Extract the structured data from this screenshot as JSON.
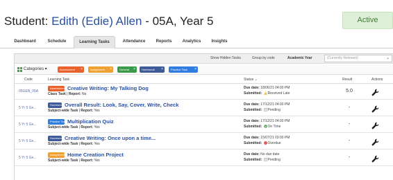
{
  "header": {
    "title_prefix": "Student: ",
    "student_name": "Edith (Edie) Allen",
    "title_suffix": " - 05A, Year 5",
    "status": "Active"
  },
  "tabs": [
    {
      "label": "Dashboard",
      "active": false
    },
    {
      "label": "Schedule",
      "active": false
    },
    {
      "label": "Learning Tasks",
      "active": true
    },
    {
      "label": "Attendance",
      "active": false
    },
    {
      "label": "Reports",
      "active": false
    },
    {
      "label": "Analytics",
      "active": false
    },
    {
      "label": "Insights",
      "active": false
    }
  ],
  "toolbar": {
    "show_hidden": "Show Hidden Tasks",
    "group_by": "Group by code",
    "academic_year_label": "Academic Year",
    "academic_year_value": "(Currently Relevant)"
  },
  "categories": {
    "label": "Categories ▾",
    "chips": [
      {
        "label": "Assessment",
        "color": "#e8602c"
      },
      {
        "label": "Assignment",
        "color": "#f0a030"
      },
      {
        "label": "General",
        "color": "#3a9a4a"
      },
      {
        "label": "Homework",
        "color": "#3d5a99"
      },
      {
        "label": "Practice Task",
        "color": "#2f7de1"
      }
    ]
  },
  "table": {
    "columns": [
      "Code",
      "Learning Task",
      "Status ⌄",
      "Result",
      "Actions"
    ],
    "rows": [
      {
        "code": "05GEN_05A",
        "category": "Assessment",
        "category_color": "#e8602c",
        "title": "Creative Writing: My Talking Dog",
        "type": "Class Task",
        "report": "No",
        "due": "18/06/21 04:00 PM",
        "submitted": "Received Late",
        "status_icon": "warning-icon",
        "result": "5.0"
      },
      {
        "code": "5 Yr 5 Ge...",
        "category": "Homework",
        "category_color": "#3d5a99",
        "title": "Overall Result: Look, Say, Cover, Write, Check",
        "type": "Subject-wide Task",
        "report": "Yes",
        "due": "17/12/21 04:00 PM",
        "submitted": "Pending",
        "status_icon": "pending-icon",
        "result": "-"
      },
      {
        "code": "5 Yr 5 Ge...",
        "category": "Practice Task",
        "category_color": "#2f7de1",
        "title": "Multiplication Quiz",
        "type": "Subject-wide Task",
        "report": "Yes",
        "due": "17/12/21 04:00 PM",
        "submitted": "On Time",
        "status_icon": "check-icon",
        "result": "-"
      },
      {
        "code": "5 Yr 5 Ge...",
        "category": "Homework",
        "category_color": "#3d5a99",
        "title": "Creative Writing: Once upon a time...",
        "type": "Subject-wide Task",
        "report": "Yes",
        "due": "15/07/21 03:00 PM",
        "submitted": "Overdue",
        "status_icon": "overdue-icon",
        "result": "-"
      },
      {
        "code": "5 Yr 5 Ge...",
        "category": "Assignment",
        "category_color": "#f0a030",
        "title": "Home Creation Project",
        "type": "Subject-wide Task",
        "report": "Yes",
        "due": "No due date",
        "submitted": "Pending",
        "status_icon": "pending-icon",
        "result": "-"
      }
    ],
    "labels": {
      "report": "Report:",
      "due": "Due date:",
      "submitted": "Submitted:"
    }
  }
}
